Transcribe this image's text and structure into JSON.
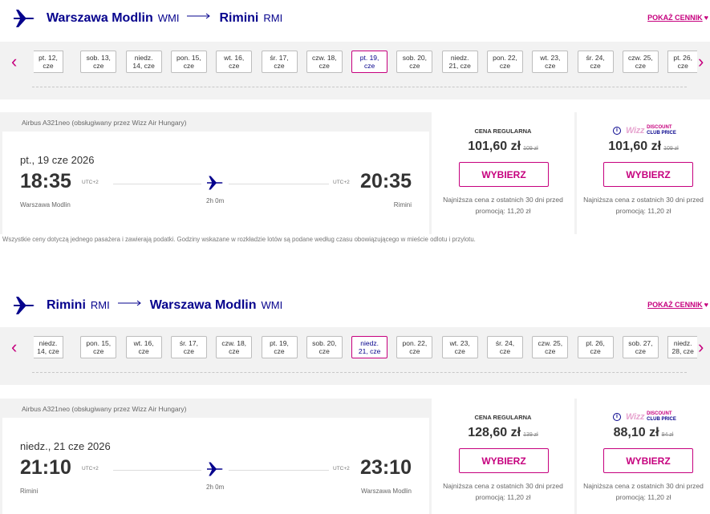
{
  "outbound": {
    "origin": "Warszawa Modlin",
    "origin_code": "WMI",
    "destination": "Rimini",
    "destination_code": "RMI",
    "show_prices": "POKAŻ CENNIK",
    "dates": [
      "pt. 12,\ncze",
      "sob. 13,\ncze",
      "niedz.\n14, cze",
      "pon. 15,\ncze",
      "wt. 16,\ncze",
      "śr. 17,\ncze",
      "czw. 18,\ncze",
      "pt. 19,\ncze",
      "sob. 20,\ncze",
      "niedz.\n21, cze",
      "pon. 22,\ncze",
      "wt. 23,\ncze",
      "śr. 24,\ncze",
      "czw. 25,\ncze",
      "pt. 26,\ncze"
    ],
    "selected_index": 7,
    "flight": {
      "aircraft": "Airbus A321neo (obsługiwany przez Wizz Air Hungary)",
      "date": "pt., 19 cze 2026",
      "departure_time": "18:35",
      "arrival_time": "20:35",
      "departure_tz": "UTC+2",
      "arrival_tz": "UTC+2",
      "duration": "2h 0m",
      "from_city": "Warszawa Modlin",
      "to_city": "Rimini"
    },
    "regular": {
      "label": "CENA REGULARNA",
      "price": "101,60 zł",
      "old_price": "109 zł",
      "button": "WYBIERZ",
      "note": "Najniższa cena z ostatnich 30 dni przed\npromocją: 11,20 zł"
    },
    "club": {
      "logo_wizz": "Wizz",
      "logo_line1": "DISCOUNT",
      "logo_line2": "CLUB PRICE",
      "price": "101,60 zł",
      "old_price": "109 zł",
      "button": "WYBIERZ",
      "note": "Najniższa cena z ostatnich 30 dni przed\npromocją: 11,20 zł"
    }
  },
  "disclaimer": "Wszystkie ceny dotyczą jednego pasażera i zawierają podatki. Godziny wskazane w rozkładzie lotów są podane według czasu obowiązującego w mieście odlotu i przylotu.",
  "inbound": {
    "origin": "Rimini",
    "origin_code": "RMI",
    "destination": "Warszawa Modlin",
    "destination_code": "WMI",
    "show_prices": "POKAŻ CENNIK",
    "dates": [
      "niedz.\n14, cze",
      "pon. 15,\ncze",
      "wt. 16,\ncze",
      "śr. 17,\ncze",
      "czw. 18,\ncze",
      "pt. 19,\ncze",
      "sob. 20,\ncze",
      "niedz.\n21, cze",
      "pon. 22,\ncze",
      "wt. 23,\ncze",
      "śr. 24,\ncze",
      "czw. 25,\ncze",
      "pt. 26,\ncze",
      "sob. 27,\ncze",
      "niedz.\n28, cze"
    ],
    "selected_index": 7,
    "flight": {
      "aircraft": "Airbus A321neo (obsługiwany przez Wizz Air Hungary)",
      "date": "niedz., 21 cze 2026",
      "departure_time": "21:10",
      "arrival_time": "23:10",
      "departure_tz": "UTC+2",
      "arrival_tz": "UTC+2",
      "duration": "2h 0m",
      "from_city": "Rimini",
      "to_city": "Warszawa Modlin"
    },
    "regular": {
      "label": "CENA REGULARNA",
      "price": "128,60 zł",
      "old_price": "139 zł",
      "button": "WYBIERZ",
      "note": "Najniższa cena z ostatnich 30 dni przed\npromocją: 11,20 zł"
    },
    "club": {
      "logo_wizz": "Wizz",
      "logo_line1": "DISCOUNT",
      "logo_line2": "CLUB PRICE",
      "price": "88,10 zł",
      "old_price": "94 zł",
      "button": "WYBIERZ",
      "note": "Najniższa cena z ostatnich 30 dni przed\npromocją: 11,20 zł"
    }
  },
  "icons": {
    "route": "airplane-icon",
    "nav_prev": "chevron-left-icon",
    "nav_next": "chevron-right-icon",
    "heart": "heart-icon",
    "info": "info-icon"
  },
  "colors": {
    "brand_navy": "#06038d",
    "brand_magenta": "#c6007e",
    "panel_grey": "#f2f2f2"
  }
}
